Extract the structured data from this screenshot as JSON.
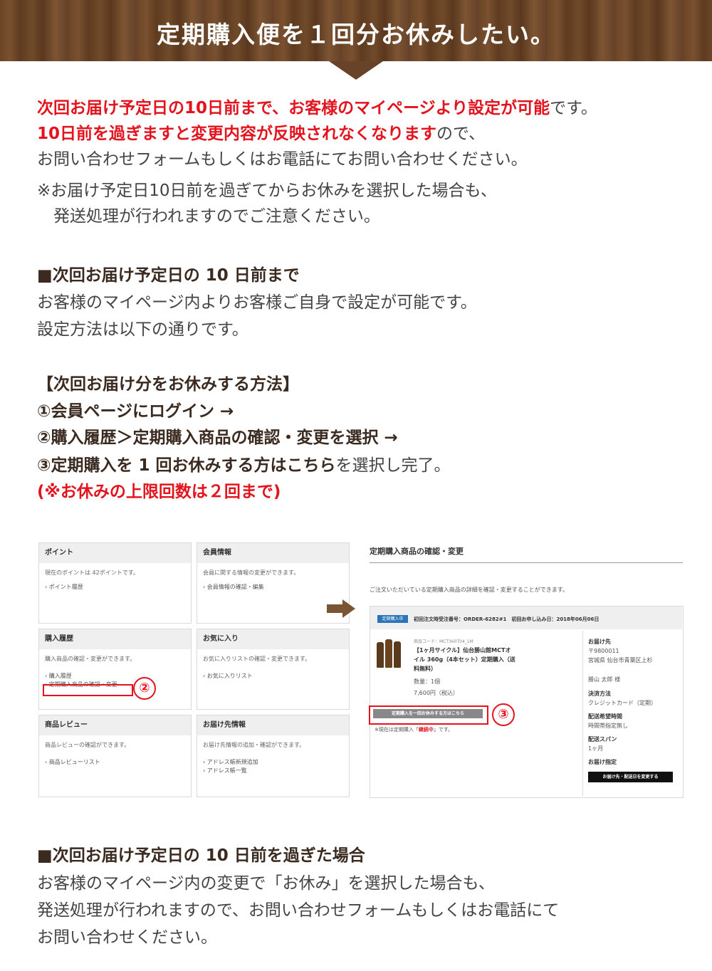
{
  "banner": {
    "title": "定期購入便を１回分お休みしたい。"
  },
  "intro": {
    "line1_red": "次回お届け予定日の10日前まで、お客様のマイページより設定が可能",
    "line1_rest": "です。",
    "line2_red": "10日前を過ぎますと変更内容が反映されなくなります",
    "line2_rest": "ので、",
    "line3": "お問い合わせフォームもしくはお電話にてお問い合わせください。",
    "line4": "※お届け予定日10日前を過ぎてからお休みを選択した場合も、",
    "line5": "　発送処理が行われますのでご注意ください。"
  },
  "section1": {
    "heading": "■次回お届け予定日の 10 日前まで",
    "text1": "お客様のマイページ内よりお客様ご自身で設定が可能です。",
    "text2": "設定方法は以下の通りです。"
  },
  "method": {
    "heading": "【次回お届け分をお休みする方法】",
    "step1": "①会員ページにログイン →",
    "step2": "②購入履歴＞定期購入商品の確認・変更を選択 →",
    "step3_bold": "③定期購入を 1 回お休みする方はこちら",
    "step3_rest": "を選択し完了。",
    "note": "(※お休みの上限回数は２回まで)"
  },
  "mypage": {
    "panels": [
      {
        "title": "ポイント",
        "desc": "現在のポイントは 42ポイントです。",
        "links": [
          "› ポイント履歴"
        ]
      },
      {
        "title": "会員情報",
        "desc": "会員に関する情報の変更ができます。",
        "links": [
          "› 会員情報の確認・編集"
        ]
      },
      {
        "title": "購入履歴",
        "desc": "購入商品の確認・変更ができます。",
        "links": [
          "› 購入履歴",
          "› 定期購入商品の確認・変更"
        ]
      },
      {
        "title": "お気に入り",
        "desc": "お気に入りリストの確認・変更できます。",
        "links": [
          "› お気に入りリスト"
        ]
      },
      {
        "title": "商品レビュー",
        "desc": "商品レビューの確認ができます。",
        "links": [
          "› 商品レビューリスト"
        ]
      },
      {
        "title": "お届け先情報",
        "desc": "お届け先情報の追加・確認ができます。",
        "links": [
          "› アドレス帳新規追加",
          "› アドレス帳一覧"
        ]
      }
    ],
    "markers": {
      "two": "②",
      "three": "③"
    }
  },
  "subscription": {
    "title": "定期購入商品の確認・変更",
    "desc": "ご注文いただいている定期購入商品の詳細を確認・変更することができます。",
    "badge": "定期購入中",
    "order_info": "初回注文時受注番号：ORDER-6282#1　初回お申し込み日：2018年06月06日",
    "product_code": "商品コード：MCT360T04_1M",
    "product_name1": "【1ヶ月サイクル】仙台勝山館MCTオ",
    "product_name2": "イル 360g（4本セット）定期購入（送",
    "product_name3": "料無料）",
    "quantity": "数量：1個",
    "price": "7,600円（税込）",
    "skip_button": "定期購入を一回お休みする方はこちら",
    "status_prefix": "※現在は定期購入「",
    "status_value": "継続中",
    "status_suffix": "」です。",
    "delivery_label": "お届け先",
    "postal": "〒9800011",
    "address": "宮城県 仙台市青葉区上杉",
    "recipient": "勝山 太郎 様",
    "payment_label": "決済方法",
    "payment": "クレジットカード（定期）",
    "time_label": "配送希望時間",
    "time": "時間帯指定無し",
    "span_label": "配送スパン",
    "span": "1ヶ月",
    "designation_label": "お届け指定",
    "change_button": "お届け先・配送日を変更する"
  },
  "section2": {
    "heading": "■次回お届け予定日の 10 日前を過ぎた場合",
    "text1": "お客様のマイページ内の変更で「お休み」を選択した場合も、",
    "text2": "発送処理が行われますので、お問い合わせフォームもしくはお電話にて",
    "text3": "お問い合わせください。"
  },
  "colors": {
    "accent_red": "#e3141e",
    "wood": "#6b4526",
    "arrow": "#7a5533"
  }
}
